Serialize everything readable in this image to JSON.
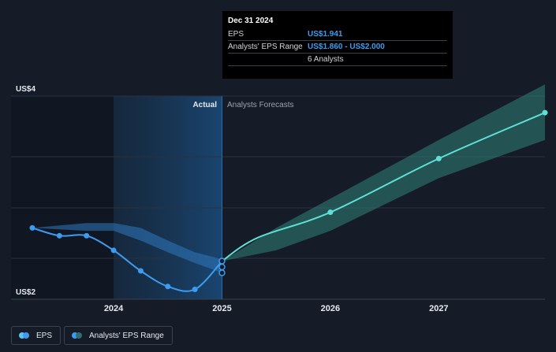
{
  "chart_data": {
    "type": "line",
    "y_top_label": "US$4",
    "y_bottom_label": "US$2",
    "ylim": [
      2,
      4
    ],
    "xlim": [
      2023.25,
      2027.98
    ],
    "x_ticks": [
      {
        "label": "2024",
        "value": 2024.0
      },
      {
        "label": "2025",
        "value": 2025.0
      },
      {
        "label": "2026",
        "value": 2026.0
      },
      {
        "label": "2027",
        "value": 2027.0
      }
    ],
    "region_labels": {
      "actual": "Actual",
      "forecast": "Analysts Forecasts"
    },
    "highlight_range": [
      2024.0,
      2025.0
    ],
    "actual_end": 2025.0,
    "series": [
      {
        "name": "EPS",
        "color": "#3d9bf0",
        "points": [
          {
            "x": 2023.25,
            "y": 2.65
          },
          {
            "x": 2023.5,
            "y": 2.57
          },
          {
            "x": 2023.75,
            "y": 2.57
          },
          {
            "x": 2024.0,
            "y": 2.42
          },
          {
            "x": 2024.25,
            "y": 2.21
          },
          {
            "x": 2024.5,
            "y": 2.05
          },
          {
            "x": 2024.75,
            "y": 2.02
          },
          {
            "x": 2025.0,
            "y": 2.31
          }
        ]
      },
      {
        "name": "EPS Forecast",
        "color": "#5ee0d6",
        "points": [
          {
            "x": 2025.0,
            "y": 2.31
          },
          {
            "x": 2025.33,
            "y": 2.55
          },
          {
            "x": 2026.0,
            "y": 2.81
          },
          {
            "x": 2027.0,
            "y": 3.36
          },
          {
            "x": 2027.98,
            "y": 3.83
          }
        ]
      }
    ],
    "past_range_band": {
      "upper": [
        {
          "x": 2023.25,
          "y": 2.65
        },
        {
          "x": 2023.75,
          "y": 2.7
        },
        {
          "x": 2024.0,
          "y": 2.7
        },
        {
          "x": 2024.25,
          "y": 2.65
        },
        {
          "x": 2024.5,
          "y": 2.52
        },
        {
          "x": 2024.75,
          "y": 2.4
        },
        {
          "x": 2025.0,
          "y": 2.33
        }
      ],
      "lower": [
        {
          "x": 2025.0,
          "y": 2.19
        },
        {
          "x": 2024.75,
          "y": 2.29
        },
        {
          "x": 2024.5,
          "y": 2.4
        },
        {
          "x": 2024.25,
          "y": 2.52
        },
        {
          "x": 2024.0,
          "y": 2.62
        },
        {
          "x": 2023.75,
          "y": 2.62
        },
        {
          "x": 2023.25,
          "y": 2.65
        }
      ]
    },
    "forecast_range_band": {
      "upper": [
        {
          "x": 2025.0,
          "y": 2.31
        },
        {
          "x": 2025.5,
          "y": 2.65
        },
        {
          "x": 2026.0,
          "y": 2.95
        },
        {
          "x": 2027.0,
          "y": 3.55
        },
        {
          "x": 2027.98,
          "y": 4.12
        }
      ],
      "lower": [
        {
          "x": 2027.98,
          "y": 3.55
        },
        {
          "x": 2027.0,
          "y": 3.16
        },
        {
          "x": 2026.0,
          "y": 2.62
        },
        {
          "x": 2025.5,
          "y": 2.42
        },
        {
          "x": 2025.0,
          "y": 2.31
        }
      ]
    },
    "highlight_markers": [
      {
        "x": 2025.0,
        "y": 2.31
      },
      {
        "x": 2025.0,
        "y": 2.25
      },
      {
        "x": 2025.0,
        "y": 2.19
      }
    ]
  },
  "tooltip": {
    "title": "Dec 31 2024",
    "eps_label": "EPS",
    "eps_value": "US$1.941",
    "range_label": "Analysts' EPS Range",
    "range_value": "US$1.860 - US$2.000",
    "analysts": "6 Analysts"
  },
  "legend": [
    {
      "label": "EPS",
      "color_a": "#5ec3f5",
      "color_b": "#3d9bf0"
    },
    {
      "label": "Analysts' EPS Range",
      "color_a": "#3d9bf0",
      "color_b": "#2f6e70"
    }
  ]
}
